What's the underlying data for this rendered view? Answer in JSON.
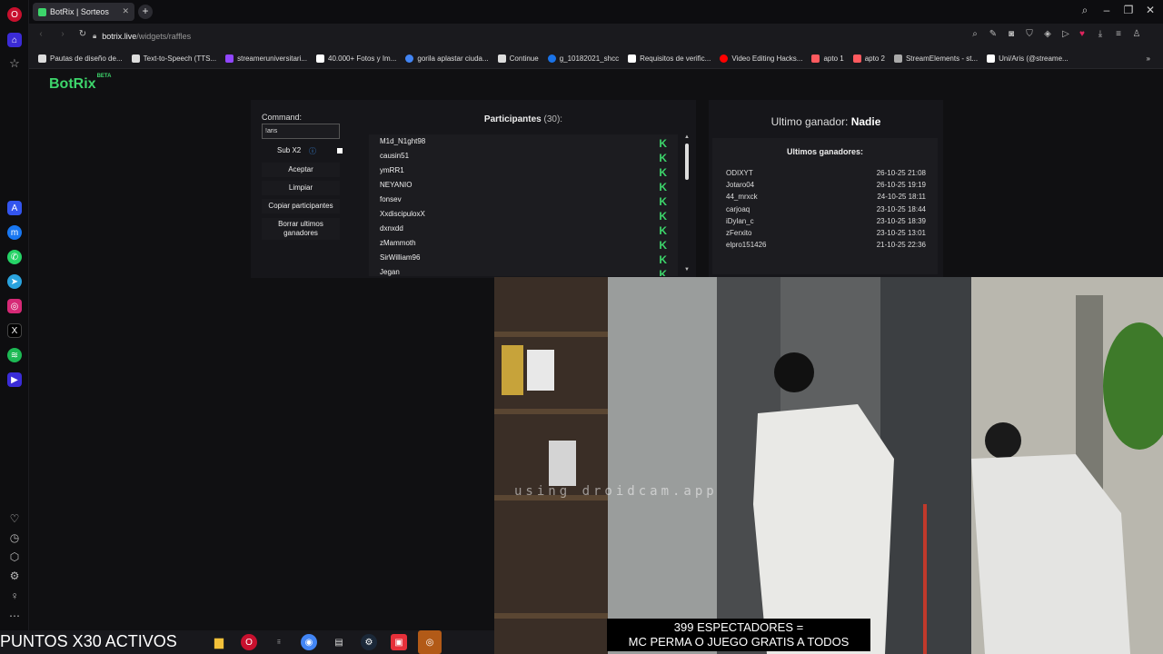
{
  "browser": {
    "tab_title": "BotRix | Sorteos",
    "url_domain": "botrix.live",
    "url_path": "/widgets/raffles"
  },
  "bookmarks": [
    {
      "label": "Pautas de diseño de...",
      "color": "#ddd"
    },
    {
      "label": "Text-to-Speech (TTS...",
      "color": "#ddd"
    },
    {
      "label": "streameruniversitari...",
      "color": "#9146ff"
    },
    {
      "label": "40.000+ Fotos y Im...",
      "color": "#fff"
    },
    {
      "label": "gorila aplastar ciuda...",
      "color": "#4285f4"
    },
    {
      "label": "Continue",
      "color": "#ddd"
    },
    {
      "label": "g_10182021_shcc",
      "color": "#1a73e8"
    },
    {
      "label": "Requisitos de verific...",
      "color": "#fff"
    },
    {
      "label": "Video Editing Hacks...",
      "color": "#ff0000"
    },
    {
      "label": "apto 1",
      "color": "#ff5a5f"
    },
    {
      "label": "apto 2",
      "color": "#ff5a5f"
    },
    {
      "label": "StreamElements - st...",
      "color": "#aaa"
    },
    {
      "label": "Uni/Aris (@streame...",
      "color": "#fff"
    }
  ],
  "page": {
    "logo": "BotRix",
    "logo_badge": "BETA",
    "command_label": "Command:",
    "command_value": "!aris",
    "sub_label": "Sub X2",
    "buttons": {
      "accept": "Aceptar",
      "clear": "Limpiar",
      "copy": "Copiar participantes",
      "delete": "Borrar ultimos ganadores"
    },
    "participants_title": "Participantes",
    "participants_count": "(30):",
    "participants": [
      "M1d_N1ght98",
      "causin51",
      "ymRR1",
      "NEYANIO",
      "fonsev",
      "XxdiscipuloxX",
      "dxnxdd",
      "zMammoth",
      "SirWilliam96",
      "Jegan"
    ],
    "platform_badge": "K",
    "last_winner_label": "Ultimo ganador:",
    "last_winner_value": "Nadie",
    "winners_title": "Ultimos ganadores:",
    "winners": [
      {
        "name": "ODIXYT",
        "date": "26-10-25 21:08"
      },
      {
        "name": "Jotaro04",
        "date": "26-10-25 19:19"
      },
      {
        "name": "44_mrxck",
        "date": "24-10-25 18:11"
      },
      {
        "name": "carjoaq",
        "date": "23-10-25 18:44"
      },
      {
        "name": "iDylan_c",
        "date": "23-10-25 18:39"
      },
      {
        "name": "zFerxito",
        "date": "23-10-25 13:01"
      },
      {
        "name": "elpro151426",
        "date": "21-10-25 22:36"
      }
    ]
  },
  "stream": {
    "watermark": "using droidcam.app",
    "overlay_line1": "399 ESPECTADORES =",
    "overlay_line2": "MC PERMA O JUEGO GRATIS A TODOS",
    "puntos": "PUNTOS X30 ACTIVOS"
  }
}
